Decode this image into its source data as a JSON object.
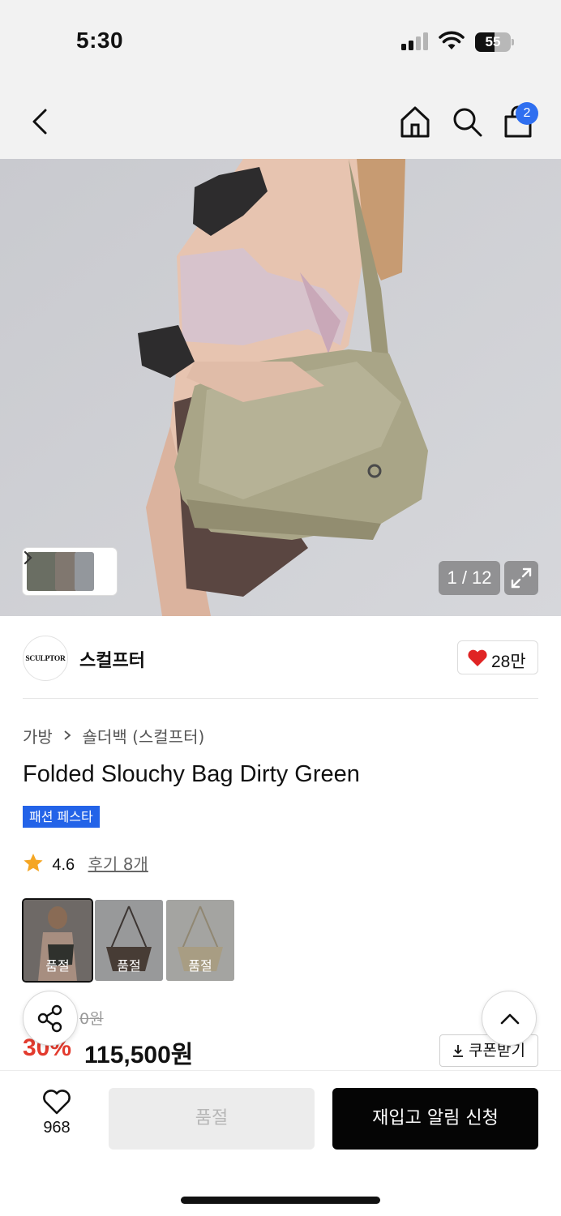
{
  "status_bar": {
    "time": "5:30",
    "battery_level": "55",
    "battery_percent": 55
  },
  "nav": {
    "cart_count": "2",
    "icons": [
      "back-arrow-icon",
      "home-icon",
      "search-icon",
      "shopping-bag-icon"
    ]
  },
  "gallery": {
    "counter": "1 / 12",
    "current": 1,
    "total": 12
  },
  "brand": {
    "logo_text": "SCULPTOR",
    "name": "스컬프터",
    "likes": "28만"
  },
  "breadcrumb": {
    "category": "가방",
    "subcategory": "숄더백 (스컬프터)"
  },
  "product": {
    "title": "Folded Slouchy Bag Dirty Green",
    "badge": "패션 페스타",
    "rating": "4.6",
    "review_label": "후기 8개"
  },
  "options": [
    {
      "label": "품절",
      "selected": true
    },
    {
      "label": "품절",
      "selected": false
    },
    {
      "label": "품절",
      "selected": false
    }
  ],
  "price": {
    "original_partial": "0원",
    "discount_partial": "30%",
    "final": "115,500원",
    "coupon_label": "쿠폰받기"
  },
  "bottom_bar": {
    "wish_count": "968",
    "soldout_label": "품절",
    "restock_label": "재입고 알림 신청"
  },
  "colors": {
    "accent_blue": "#2363e8",
    "badge_blue": "#2f6ff0",
    "discount_red": "#e33b2e",
    "heart_red": "#e02424"
  }
}
